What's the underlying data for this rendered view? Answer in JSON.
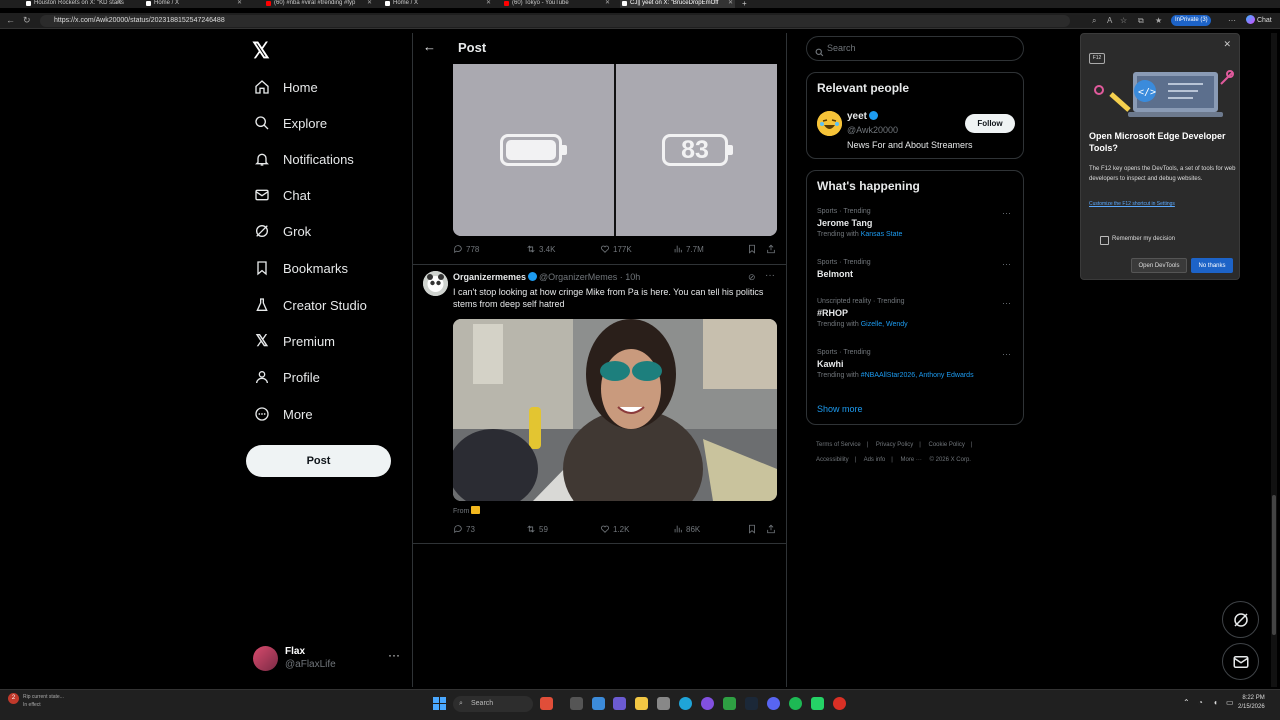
{
  "browser": {
    "tabs": [
      {
        "title": "Houston Rockets on X: \"KD starts"
      },
      {
        "title": "Home / X"
      },
      {
        "title": "(60) #nba #viral #trending #fyp"
      },
      {
        "title": "Home / X"
      },
      {
        "title": "(60) Tokyo - YouTube"
      },
      {
        "title": "CJ|| yeet on X: \"BruceDropEmOff"
      }
    ],
    "url": "https://x.com/Awk20000/status/2023188152547246488",
    "inprivate_label": "InPrivate (3)",
    "chat_label": "Chat"
  },
  "sidebar": {
    "logo": "𝕏",
    "items": [
      {
        "label": "Home",
        "icon": "home-icon"
      },
      {
        "label": "Explore",
        "icon": "search-icon"
      },
      {
        "label": "Notifications",
        "icon": "bell-icon"
      },
      {
        "label": "Chat",
        "icon": "mail-icon"
      },
      {
        "label": "Grok",
        "icon": "grok-icon"
      },
      {
        "label": "Bookmarks",
        "icon": "bookmark-icon"
      },
      {
        "label": "Creator Studio",
        "icon": "flask-icon"
      },
      {
        "label": "Premium",
        "icon": "x-premium-icon"
      },
      {
        "label": "Profile",
        "icon": "person-icon"
      },
      {
        "label": "More",
        "icon": "more-circle-icon"
      }
    ],
    "post_button": "Post",
    "account": {
      "name": "Flax",
      "handle": "@aFlaxLife",
      "more": "···"
    }
  },
  "main": {
    "header_title": "Post",
    "first_post": {
      "image_number": "83",
      "replies": "778",
      "reposts": "3.4K",
      "likes": "177K",
      "views": "7.7M"
    },
    "second_post": {
      "author": "Organizermemes",
      "handle": "@OrganizerMemes",
      "time": "· 10h",
      "text": "I can't stop looking at how cringe Mike from Pa is here. You can tell his politics stems from deep self hatred",
      "from_label": "From",
      "replies": "73",
      "reposts": "59",
      "likes": "1.2K",
      "views": "86K"
    }
  },
  "right": {
    "search_placeholder": "Search",
    "relevant": {
      "title": "Relevant people",
      "name": "yeet",
      "handle": "@Awk20000",
      "bio": "News For and About Streamers",
      "follow": "Follow"
    },
    "happening": {
      "title": "What's happening",
      "trends": [
        {
          "context": "Sports · Trending",
          "name": "Jerome Tang",
          "with_prefix": "Trending with ",
          "with": "Kansas State"
        },
        {
          "context": "Sports · Trending",
          "name": "Belmont",
          "with_prefix": "",
          "with": ""
        },
        {
          "context": "Unscripted reality · Trending",
          "name": "#RHOP",
          "with_prefix": "Trending with ",
          "with": "Gizelle, Wendy"
        },
        {
          "context": "Sports · Trending",
          "name": "Kawhi",
          "with_prefix": "Trending with ",
          "with": "#NBAAllStar2026, Anthony Edwards"
        }
      ],
      "show_more": "Show more"
    },
    "footer": {
      "links": [
        "Terms of Service",
        "|",
        "Privacy Policy",
        "|",
        "Cookie Policy",
        "|"
      ],
      "links2": [
        "Accessibility",
        "|",
        "Ads info",
        "|",
        "More ···",
        "© 2026 X Corp."
      ]
    }
  },
  "devtools_popup": {
    "key_label": "F12",
    "title": "Open Microsoft Edge Developer Tools?",
    "description": "The F12 key opens the DevTools, a set of tools for web developers to inspect and debug websites.",
    "link": "Customize the F12 shortcut in Settings",
    "remember": "Remember my decision",
    "open_button": "Open DevTools",
    "no_button": "No thanks"
  },
  "taskbar": {
    "note": "Rip current state...",
    "note2": "In effect",
    "search": "Search",
    "time": "8:22 PM",
    "date": "2/15/2026"
  },
  "colors": {
    "accent": "#1d9bf0",
    "edge_blue": "#1d63c7"
  }
}
